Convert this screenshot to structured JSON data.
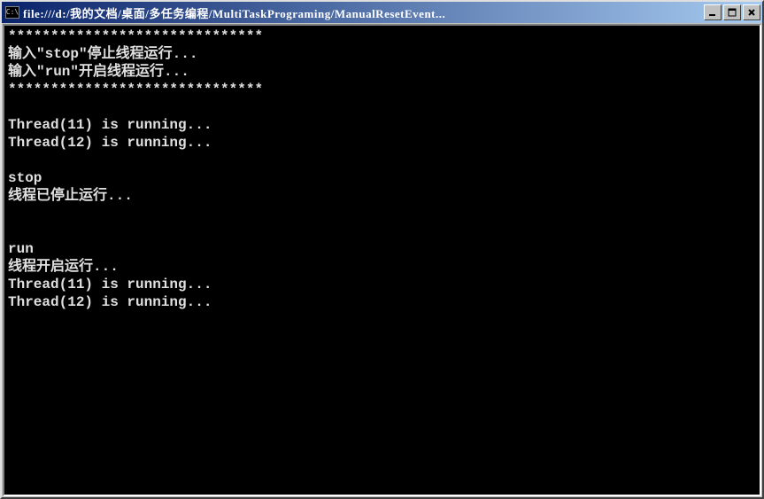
{
  "window": {
    "icon_text": "C:\\",
    "title": "file:///d:/我的文档/桌面/多任务编程/MultiTaskPrograming/ManualResetEvent..."
  },
  "console": {
    "lines": [
      "******************************",
      "输入\"stop\"停止线程运行...",
      "输入\"run\"开启线程运行...",
      "******************************",
      "",
      "Thread(11) is running...",
      "Thread(12) is running...",
      "",
      "stop",
      "线程已停止运行...",
      "",
      "",
      "run",
      "线程开启运行...",
      "Thread(11) is running...",
      "Thread(12) is running..."
    ]
  }
}
